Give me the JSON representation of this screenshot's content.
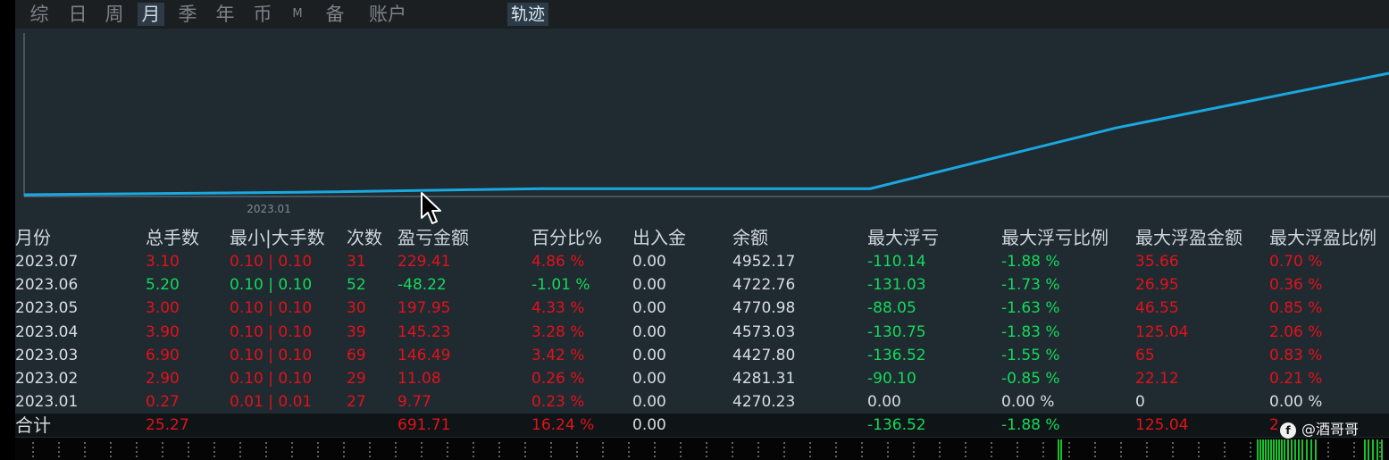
{
  "toolbar": {
    "tabs": [
      {
        "label": "综"
      },
      {
        "label": "日"
      },
      {
        "label": "周"
      },
      {
        "label": "月",
        "active": true
      },
      {
        "label": "季"
      },
      {
        "label": "年"
      },
      {
        "label": "币"
      },
      {
        "label": "M"
      },
      {
        "label": "备"
      },
      {
        "label": "账户"
      }
    ],
    "trajectory_label": "轨迹"
  },
  "chart_data": {
    "type": "line",
    "x_tick_label": "2023.01",
    "series": [
      {
        "color": "#1aa8e0",
        "x": [
          0,
          0.2,
          0.38,
          0.62,
          0.8,
          1.0
        ],
        "y": [
          0,
          0.02,
          0.05,
          0.05,
          0.55,
          1.0
        ]
      }
    ],
    "ylim": [
      0,
      1
    ],
    "grid": false
  },
  "table": {
    "columns": [
      "月份",
      "总手数",
      "最小|大手数",
      "次数",
      "盈亏金额",
      "百分比%",
      "出入金",
      "余额",
      "最大浮亏",
      "最大浮亏比例",
      "最大浮盈金额",
      "最大浮盈比例"
    ],
    "rows": [
      {
        "month": "2023.07",
        "total_lots": "3.10",
        "min_max_lots": "0.10 | 0.10",
        "count": "31",
        "pnl": "229.41",
        "percent": "4.86 %",
        "in_out": "0.00",
        "balance": "4952.17",
        "max_float_loss": "-110.14",
        "max_float_loss_ratio": "-1.88 %",
        "max_float_profit": "35.66",
        "max_float_profit_ratio": "0.70 %",
        "tone": "red"
      },
      {
        "month": "2023.06",
        "total_lots": "5.20",
        "min_max_lots": "0.10 | 0.10",
        "count": "52",
        "pnl": "-48.22",
        "percent": "-1.01 %",
        "in_out": "0.00",
        "balance": "4722.76",
        "max_float_loss": "-131.03",
        "max_float_loss_ratio": "-1.73 %",
        "max_float_profit": "26.95",
        "max_float_profit_ratio": "0.36 %",
        "tone": "green"
      },
      {
        "month": "2023.05",
        "total_lots": "3.00",
        "min_max_lots": "0.10 | 0.10",
        "count": "30",
        "pnl": "197.95",
        "percent": "4.33 %",
        "in_out": "0.00",
        "balance": "4770.98",
        "max_float_loss": "-88.05",
        "max_float_loss_ratio": "-1.63 %",
        "max_float_profit": "46.55",
        "max_float_profit_ratio": "0.85 %",
        "tone": "red"
      },
      {
        "month": "2023.04",
        "total_lots": "3.90",
        "min_max_lots": "0.10 | 0.10",
        "count": "39",
        "pnl": "145.23",
        "percent": "3.28 %",
        "in_out": "0.00",
        "balance": "4573.03",
        "max_float_loss": "-130.75",
        "max_float_loss_ratio": "-1.83 %",
        "max_float_profit": "125.04",
        "max_float_profit_ratio": "2.06 %",
        "tone": "red"
      },
      {
        "month": "2023.03",
        "total_lots": "6.90",
        "min_max_lots": "0.10 | 0.10",
        "count": "69",
        "pnl": "146.49",
        "percent": "3.42 %",
        "in_out": "0.00",
        "balance": "4427.80",
        "max_float_loss": "-136.52",
        "max_float_loss_ratio": "-1.55 %",
        "max_float_profit": "65",
        "max_float_profit_ratio": "0.83 %",
        "tone": "red"
      },
      {
        "month": "2023.02",
        "total_lots": "2.90",
        "min_max_lots": "0.10 | 0.10",
        "count": "29",
        "pnl": "11.08",
        "percent": "0.26 %",
        "in_out": "0.00",
        "balance": "4281.31",
        "max_float_loss": "-90.10",
        "max_float_loss_ratio": "-0.85 %",
        "max_float_profit": "22.12",
        "max_float_profit_ratio": "0.21 %",
        "tone": "red"
      },
      {
        "month": "2023.01",
        "total_lots": "0.27",
        "min_max_lots": "0.01 | 0.01",
        "count": "27",
        "pnl": "9.77",
        "percent": "0.23 %",
        "in_out": "0.00",
        "balance": "4270.23",
        "max_float_loss": "0.00",
        "max_float_loss_ratio": "0.00 %",
        "max_float_profit": "0",
        "max_float_profit_ratio": "0.00 %",
        "tone": "red",
        "neutral_tail": true
      }
    ],
    "total": {
      "label": "合计",
      "total_lots": "25.27",
      "pnl": "691.71",
      "percent": "16.24 %",
      "in_out": "0.00",
      "max_float_loss": "-136.52",
      "max_float_loss_ratio": "-1.88 %",
      "max_float_profit": "125.04",
      "max_float_profit_ratio": "2"
    }
  },
  "watermark": {
    "icon": "f",
    "text": "@酒哥哥"
  },
  "colors": {
    "positive": "#e3121a",
    "negative": "#14d95a",
    "neutral": "#d8dde2",
    "line": "#1aa8e0"
  }
}
